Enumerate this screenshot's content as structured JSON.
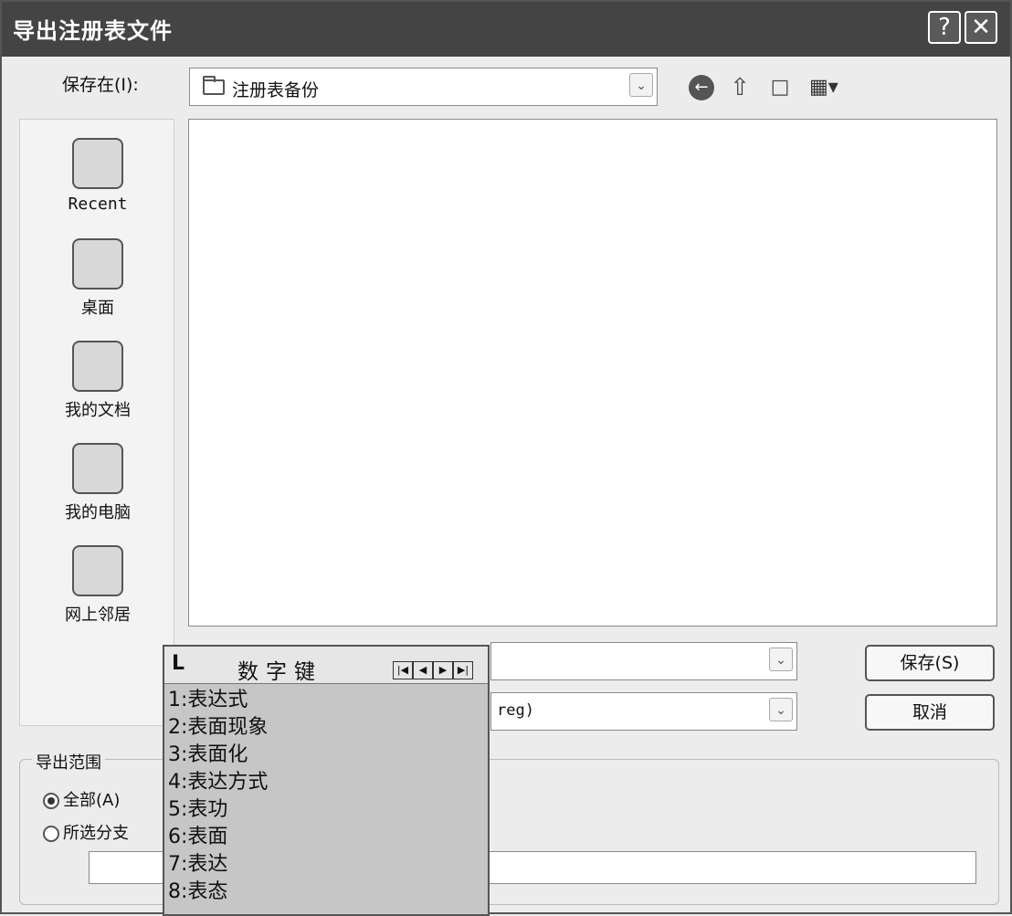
{
  "window": {
    "title": "导出注册表文件",
    "help_glyph": "?",
    "close_glyph": "✕"
  },
  "toolbar": {
    "save_in_label": "保存在(I):",
    "current_folder": "注册表备份",
    "combo_arrow": "⌄",
    "icons": [
      "back-icon",
      "up-folder-icon",
      "new-folder-icon",
      "view-menu-icon"
    ]
  },
  "places": [
    {
      "label": "Recent",
      "icon": "recent-folder-icon"
    },
    {
      "label": "桌面",
      "icon": "desktop-icon"
    },
    {
      "label": "我的文档",
      "icon": "my-documents-icon"
    },
    {
      "label": "我的电脑",
      "icon": "my-computer-icon"
    },
    {
      "label": "网上邻居",
      "icon": "network-places-icon"
    }
  ],
  "file_type_visible": "reg)",
  "buttons": {
    "save": "保存(S)",
    "cancel": "取消"
  },
  "export_range": {
    "title": "导出范围",
    "all_label": "全部(A)",
    "selected_branch_label": "所选分支",
    "selected": "all"
  },
  "ime": {
    "logo": "L",
    "title": "数字键",
    "nav": [
      "|◀",
      "◀",
      "▶",
      "▶|"
    ],
    "candidates": [
      "1:表达式",
      "2:表面现象",
      "3:表面化",
      "4:表达方式",
      "5:表功",
      "6:表面",
      "7:表达",
      "8:表态"
    ]
  }
}
